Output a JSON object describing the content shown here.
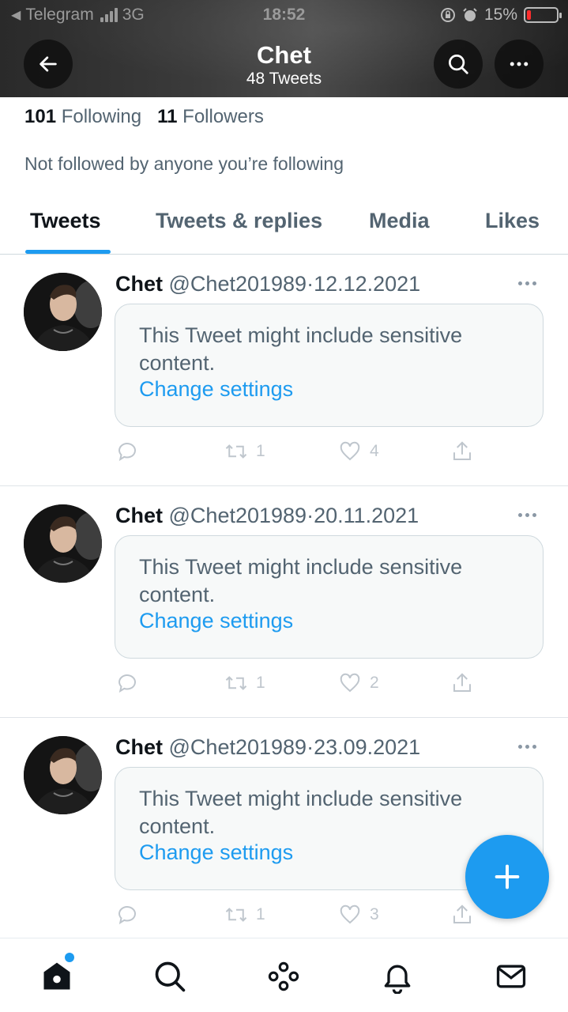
{
  "status_bar": {
    "carrier": "Telegram",
    "network": "3G",
    "time": "18:52",
    "battery": "15%",
    "battery_level": 0.15
  },
  "header": {
    "title": "Chet",
    "subtitle": "48 Tweets"
  },
  "profile": {
    "following_count": "101",
    "following_label": "Following",
    "followers_count": "11",
    "followers_label": "Followers",
    "not_followed_text": "Not followed by anyone you’re following"
  },
  "tabs": [
    {
      "label": "Tweets",
      "active": true
    },
    {
      "label": "Tweets & replies",
      "active": false
    },
    {
      "label": "Media",
      "active": false
    },
    {
      "label": "Likes",
      "active": false
    }
  ],
  "tweets": [
    {
      "name": "Chet",
      "handle": "@Chet201989",
      "separator": "·",
      "date": "12.12.2021",
      "sensitive_text": "This Tweet might include sensitive content.",
      "link_text": "Change settings",
      "retweets": "1",
      "likes": "4"
    },
    {
      "name": "Chet",
      "handle": "@Chet201989",
      "separator": "·",
      "date": "20.11.2021",
      "sensitive_text": "This Tweet might include sensitive content.",
      "link_text": "Change settings",
      "retweets": "1",
      "likes": "2"
    },
    {
      "name": "Chet",
      "handle": "@Chet201989",
      "separator": "·",
      "date": "23.09.2021",
      "sensitive_text": "This Tweet might include sensitive content.",
      "link_text": "Change settings",
      "retweets": "1",
      "likes": "3"
    }
  ],
  "colors": {
    "accent": "#1d9bf0",
    "text_primary": "#0f1419",
    "text_secondary": "#536471"
  },
  "icons": {
    "header": [
      "back-arrow-icon",
      "search-icon",
      "more-icon"
    ],
    "bottom_nav": [
      "home-icon",
      "search-icon",
      "spaces-icon",
      "bell-icon",
      "mail-icon"
    ]
  }
}
